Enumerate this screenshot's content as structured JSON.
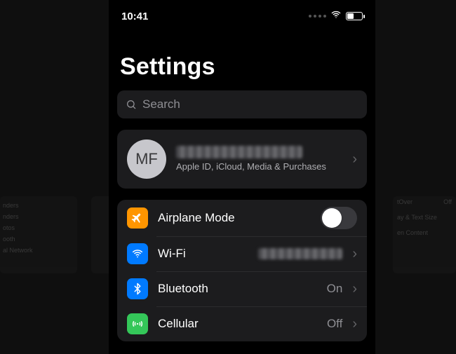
{
  "status": {
    "time": "10:41"
  },
  "title": "Settings",
  "search": {
    "placeholder": "Search"
  },
  "profile": {
    "initials": "MF",
    "subtitle": "Apple ID, iCloud, Media & Purchases"
  },
  "rows": {
    "airplane": {
      "label": "Airplane Mode",
      "on": false
    },
    "wifi": {
      "label": "Wi-Fi"
    },
    "bluetooth": {
      "label": "Bluetooth",
      "value": "On"
    },
    "cellular": {
      "label": "Cellular",
      "value": "Off"
    }
  },
  "bg_left": [
    "nders",
    "nders",
    "otos",
    "ooth",
    "al Network"
  ],
  "bg_right": [
    {
      "l": "tOver",
      "v": "Off"
    },
    {
      "l": "",
      "v": ""
    },
    {
      "l": "ay & Text Size",
      "v": ""
    },
    {
      "l": "",
      "v": ""
    },
    {
      "l": "en Content",
      "v": ""
    }
  ]
}
